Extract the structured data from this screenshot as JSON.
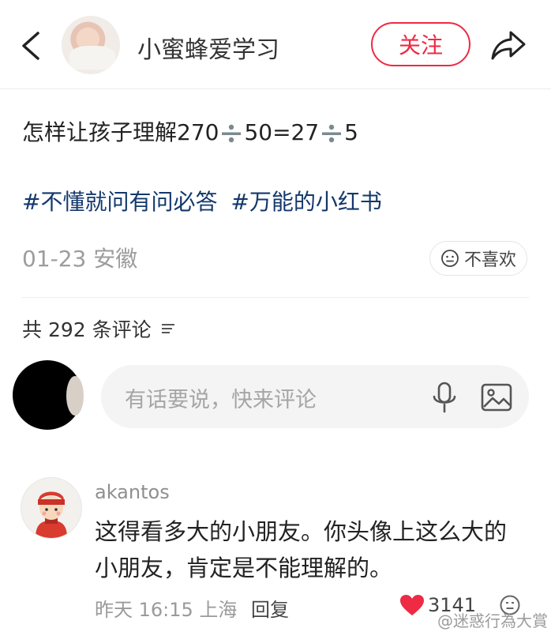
{
  "header": {
    "author_name": "小蜜蜂爱学习",
    "follow_label": "关注",
    "icons": [
      "back-arrow-icon",
      "share-icon"
    ]
  },
  "post": {
    "title_part1": "怎样让孩子理解270",
    "title_part2": "50=27",
    "title_part3": "5",
    "tags": [
      "#不懂就问有问必答",
      "#万能的小红书"
    ],
    "meta": "01-23 安徽",
    "dislike_label": "不喜欢"
  },
  "comments_header": {
    "count_label": "共 292 条评论"
  },
  "comment_input": {
    "placeholder": "有话要说，快来评论"
  },
  "comment": {
    "author": "akantos",
    "text": "这得看多大的小朋友。你头像上这么大的小朋友，肯定是不能理解的。",
    "time_location": "昨天 16:15 上海",
    "reply_label": "回复",
    "likes": "3141"
  },
  "watermark": "@迷惑行為大賞",
  "colors": {
    "accent_red": "#ee2a44",
    "tag_blue": "#13386c",
    "heart_red": "#ee2a44"
  }
}
